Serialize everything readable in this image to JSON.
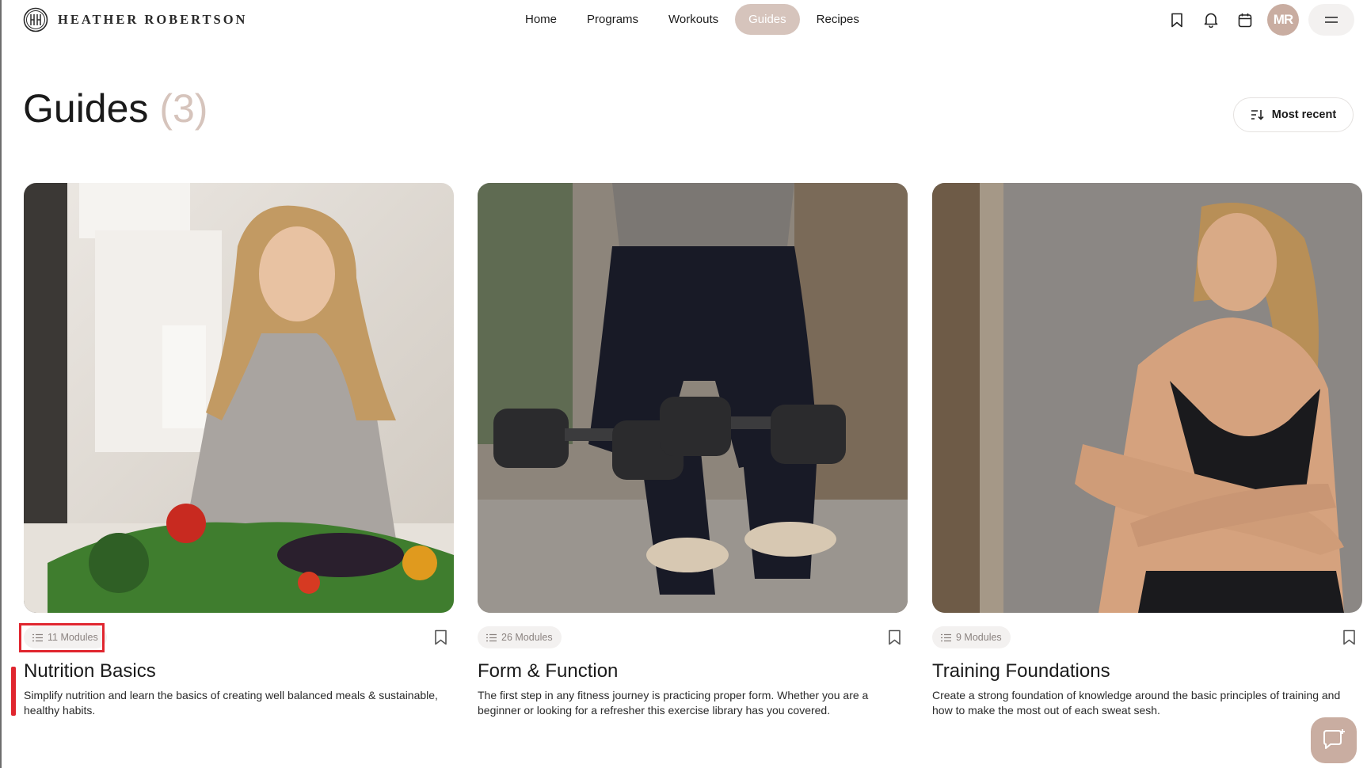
{
  "brand": {
    "name": "HEATHER ROBERTSON"
  },
  "nav": {
    "items": [
      {
        "label": "Home",
        "active": false
      },
      {
        "label": "Programs",
        "active": false
      },
      {
        "label": "Workouts",
        "active": false
      },
      {
        "label": "Guides",
        "active": true
      },
      {
        "label": "Recipes",
        "active": false
      }
    ]
  },
  "header": {
    "icons": [
      "bookmark-icon",
      "bell-icon",
      "calendar-icon"
    ],
    "avatar_initials": "MR",
    "menu_icon": "hamburger-icon"
  },
  "page": {
    "title": "Guides",
    "count": "(3)",
    "sort_label": "Most recent"
  },
  "cards": [
    {
      "modules": "11 Modules",
      "title": "Nutrition Basics",
      "description": "Simplify nutrition and learn the basics of creating well balanced meals & sustainable, healthy habits.",
      "image": "woman-with-vegetables-photo"
    },
    {
      "modules": "26 Modules",
      "title": "Form & Function",
      "description": "The first step in any fitness journey is practicing proper form. Whether you are a beginner or looking for a refresher this exercise library has you covered.",
      "image": "squat-with-dumbbells-photo"
    },
    {
      "modules": "9 Modules",
      "title": "Training Foundations",
      "description": "Create a strong foundation of knowledge around the basic principles of training and how to make the most out of each sweat sesh.",
      "image": "woman-arms-crossed-photo"
    }
  ],
  "colors": {
    "accent": "#d6c4bc",
    "avatar": "#c9ada1",
    "highlight": "#e0262f"
  }
}
